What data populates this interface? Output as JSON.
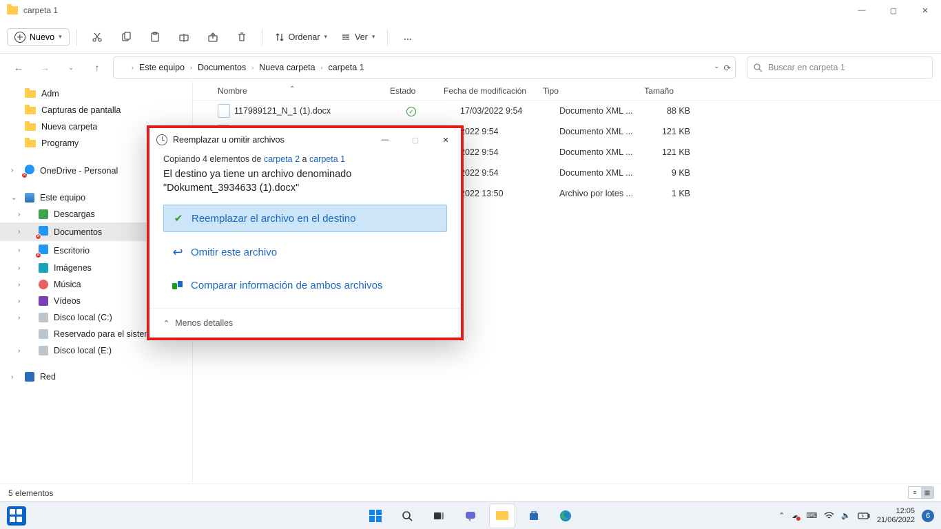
{
  "window": {
    "title": "carpeta 1",
    "minimize": "—",
    "maximize": "▢",
    "close": "✕"
  },
  "toolbar": {
    "new": "Nuevo",
    "sort": "Ordenar",
    "view": "Ver",
    "more": "…"
  },
  "address": {
    "root": "Este equipo",
    "p1": "Documentos",
    "p2": "Nueva carpeta",
    "p3": "carpeta 1"
  },
  "search": {
    "placeholder": "Buscar en carpeta 1"
  },
  "sidebar": {
    "quick": [
      "Adm",
      "Capturas de pantalla",
      "Nueva carpeta",
      "Programy"
    ],
    "onedrive": "OneDrive - Personal",
    "thispc": "Este equipo",
    "thispc_items": [
      "Descargas",
      "Documentos",
      "Escritorio",
      "Imágenes",
      "Música",
      "Vídeos",
      "Disco local (C:)",
      "Reservado para el sistema (D:)",
      "Disco local (E:)"
    ],
    "net": "Red"
  },
  "columns": {
    "name": "Nombre",
    "status": "Estado",
    "modified": "Fecha de modificación",
    "type": "Tipo",
    "size": "Tamaño"
  },
  "files": [
    {
      "name": "117989121_N_1 (1).docx",
      "status": "✓",
      "date": "17/03/2022 9:54",
      "type": "Documento XML ...",
      "size": "88 KB"
    },
    {
      "name": "",
      "status": "",
      "date": "2022 9:54",
      "type": "Documento XML ...",
      "size": "121 KB"
    },
    {
      "name": "",
      "status": "",
      "date": "2022 9:54",
      "type": "Documento XML ...",
      "size": "121 KB"
    },
    {
      "name": "",
      "status": "",
      "date": "2022 9:54",
      "type": "Documento XML ...",
      "size": "9 KB"
    },
    {
      "name": "",
      "status": "",
      "date": "2022 13:50",
      "type": "Archivo por lotes ...",
      "size": "1 KB"
    }
  ],
  "statusbar": {
    "count": "5 elementos"
  },
  "dialog": {
    "title": "Reemplazar u omitir archivos",
    "copy_prefix": "Copiando 4 elementos de ",
    "src": "carpeta 2",
    "a": " a ",
    "dst": "carpeta 1",
    "msg1": "El destino ya tiene un archivo denominado",
    "msg2": "\"Dokument_3934633 (1).docx\"",
    "opt_replace": "Reemplazar el archivo en el destino",
    "opt_skip": "Omitir este archivo",
    "opt_compare": "Comparar información de ambos archivos",
    "less": "Menos detalles"
  },
  "taskbar": {
    "time": "12:05",
    "date": "21/06/2022",
    "badge": "6"
  }
}
